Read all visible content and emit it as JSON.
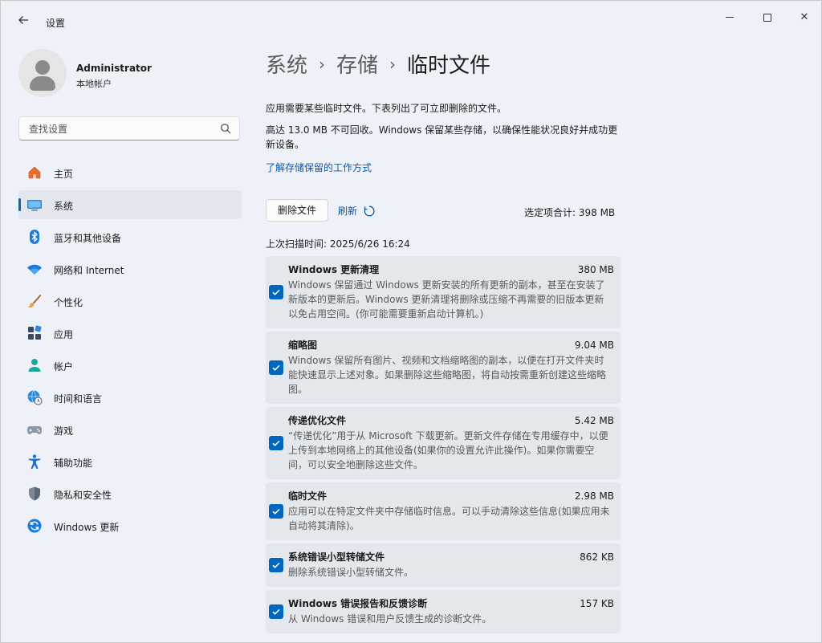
{
  "app": {
    "title": "设置"
  },
  "window_controls": {
    "minimize": "minimize",
    "maximize": "maximize",
    "close": "✕"
  },
  "user": {
    "name": "Administrator",
    "account_type": "本地帐户"
  },
  "search": {
    "placeholder": "查找设置"
  },
  "nav": {
    "items": [
      {
        "label": "主页",
        "icon": "home-icon",
        "active": false
      },
      {
        "label": "系统",
        "icon": "system-icon",
        "active": true
      },
      {
        "label": "蓝牙和其他设备",
        "icon": "bluetooth-icon",
        "active": false
      },
      {
        "label": "网络和 Internet",
        "icon": "wifi-icon",
        "active": false
      },
      {
        "label": "个性化",
        "icon": "brush-icon",
        "active": false
      },
      {
        "label": "应用",
        "icon": "apps-icon",
        "active": false
      },
      {
        "label": "帐户",
        "icon": "account-icon",
        "active": false
      },
      {
        "label": "时间和语言",
        "icon": "globe-clock-icon",
        "active": false
      },
      {
        "label": "游戏",
        "icon": "gamepad-icon",
        "active": false
      },
      {
        "label": "辅助功能",
        "icon": "accessibility-icon",
        "active": false
      },
      {
        "label": "隐私和安全性",
        "icon": "shield-icon",
        "active": false
      },
      {
        "label": "Windows 更新",
        "icon": "update-icon",
        "active": false
      }
    ]
  },
  "breadcrumb": {
    "level1": "系统",
    "level2": "存储",
    "current": "临时文件",
    "separator": "›"
  },
  "description": {
    "line1": "应用需要某些临时文件。下表列出了可立即删除的文件。",
    "line2": "高达 13.0 MB 不可回收。Windows 保留某些存储，以确保性能状况良好并成功更新设备。",
    "link": "了解存储保留的工作方式"
  },
  "actions": {
    "delete_label": "删除文件",
    "refresh_label": "刷新",
    "total": "选定项合计: 398 MB"
  },
  "scan_time": "上次扫描时间: 2025/6/26 16:24",
  "accent_color": "#0067c0",
  "items": [
    {
      "name": "Windows 更新清理",
      "size": "380 MB",
      "checked": true,
      "description": "Windows 保留通过 Windows 更新安装的所有更新的副本，甚至在安装了新版本的更新后。Windows 更新清理将删除或压缩不再需要的旧版本更新以免占用空间。(你可能需要重新启动计算机。)"
    },
    {
      "name": "缩略图",
      "size": "9.04 MB",
      "checked": true,
      "description": "Windows 保留所有图片、视频和文档缩略图的副本，以便在打开文件夹时能快速显示上述对象。如果删除这些缩略图，将自动按需重新创建这些缩略图。"
    },
    {
      "name": "传递优化文件",
      "size": "5.42 MB",
      "checked": true,
      "description": "“传递优化”用于从 Microsoft 下载更新。更新文件存储在专用缓存中，以便上传到本地网络上的其他设备(如果你的设置允许此操作)。如果你需要空间，可以安全地删除这些文件。"
    },
    {
      "name": "临时文件",
      "size": "2.98 MB",
      "checked": true,
      "description": "应用可以在特定文件夹中存储临时信息。可以手动清除这些信息(如果应用未自动将其清除)。"
    },
    {
      "name": "系统错误小型转储文件",
      "size": "862 KB",
      "checked": true,
      "description": "删除系统错误小型转储文件。"
    },
    {
      "name": "Windows 错误报告和反馈诊断",
      "size": "157 KB",
      "checked": true,
      "description": "从 Windows 错误和用户反馈生成的诊断文件。"
    }
  ]
}
